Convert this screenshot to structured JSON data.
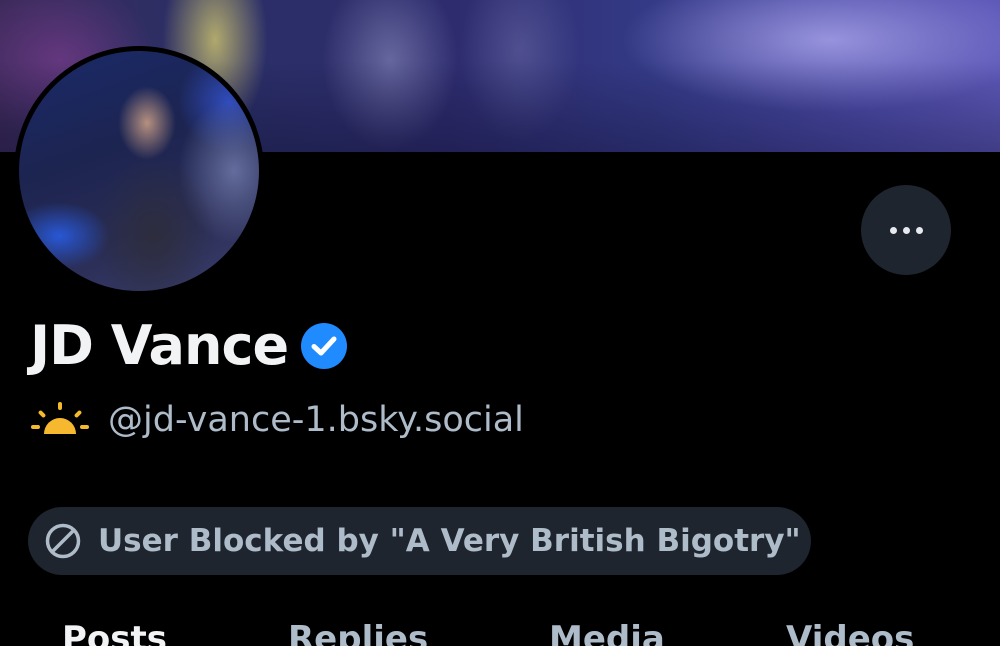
{
  "profile": {
    "display_name": "JD Vance",
    "handle": "@jd-vance-1.bsky.social",
    "verified": true,
    "blocked_notice": "User Blocked by \"A Very British Bigotry\""
  },
  "tabs": [
    {
      "label": "Posts",
      "active": true
    },
    {
      "label": "Replies",
      "active": false
    },
    {
      "label": "Media",
      "active": false
    },
    {
      "label": "Videos",
      "active": false
    }
  ],
  "icons": {
    "verified": "verified-check-icon",
    "handle_prefix": "sunrise-icon",
    "blocked": "block-icon",
    "more": "more-options-icon"
  },
  "colors": {
    "background": "#000000",
    "text_primary": "#f1f3f5",
    "text_secondary": "#aebbc9",
    "pill_bg": "#1e252e",
    "verified_blue": "#208bfe",
    "sun_yellow": "#f5b82e"
  }
}
